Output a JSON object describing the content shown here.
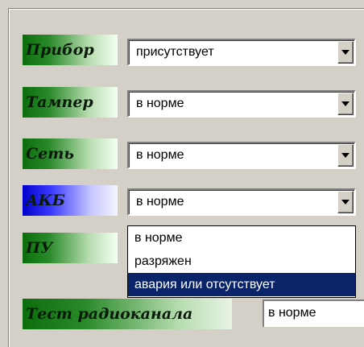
{
  "rows": [
    {
      "label": "Прибор",
      "value": "присутствует"
    },
    {
      "label": "Тампер",
      "value": "в норме"
    },
    {
      "label": "Сеть",
      "value": "в норме"
    },
    {
      "label": "АКБ",
      "value": "в норме"
    },
    {
      "label": "ПУ"
    }
  ],
  "dropdown": {
    "options": [
      "в норме",
      "разряжен",
      "авария или отсутствует"
    ],
    "selected": "авария или отсутствует"
  },
  "radio_test": {
    "label": "Тест радиоканала",
    "value": "в норме"
  },
  "colors": {
    "label_gradient_green": "#0b6e0b",
    "label_gradient_blue": "#0000cc",
    "selection": "#0a246a",
    "window": "#d4d0c8"
  }
}
